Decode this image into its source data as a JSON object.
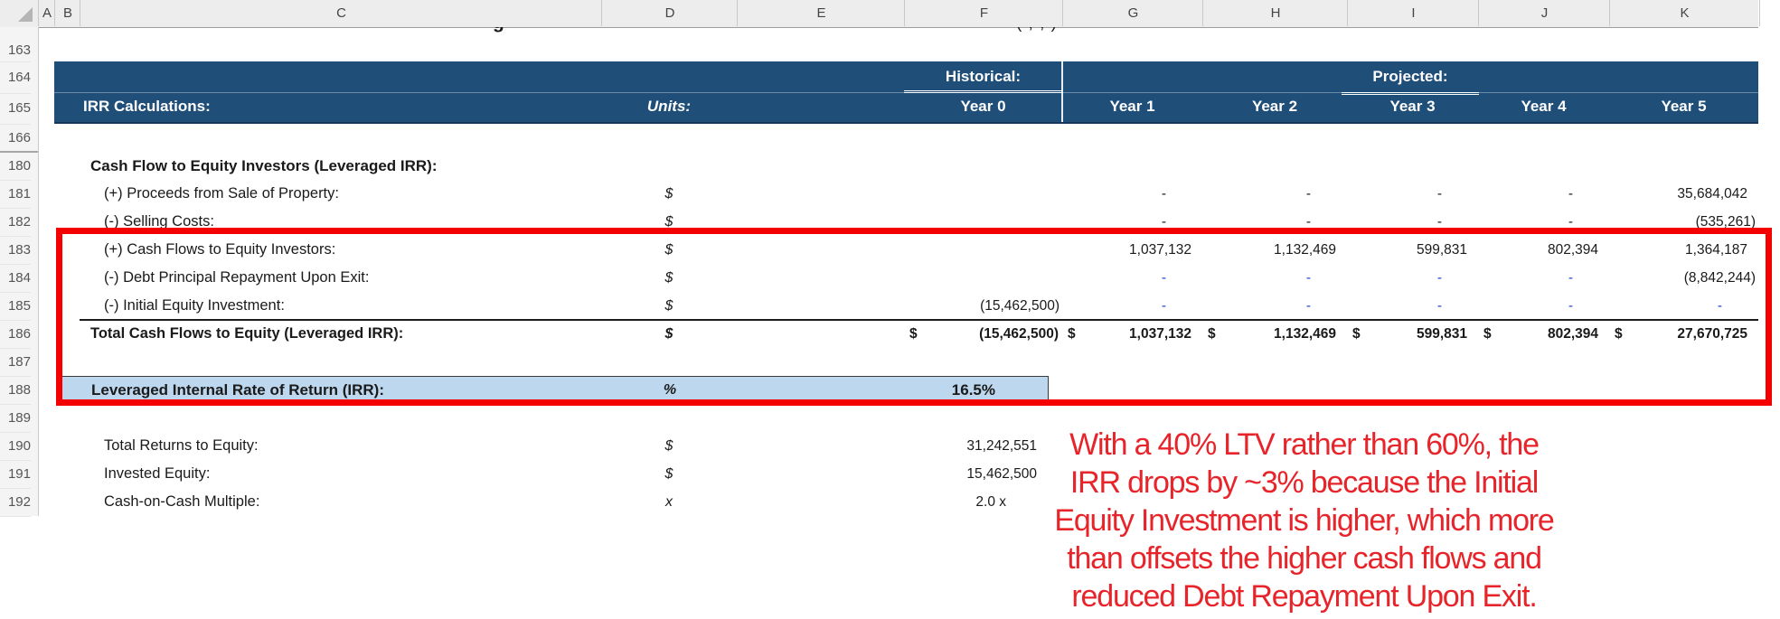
{
  "colors": {
    "header_navy": "#1F4E79",
    "highlight_blue": "#BDD7EE",
    "annotation_red": "#E8242B",
    "box_red": "#F40000",
    "input_value_blue": "#2244CC"
  },
  "column_letters": [
    "A",
    "B",
    "C",
    "D",
    "E",
    "F",
    "G",
    "H",
    "I",
    "J",
    "K"
  ],
  "row_numbers": [
    "163",
    "164",
    "165",
    "166",
    "180",
    "181",
    "182",
    "183",
    "184",
    "185",
    "186",
    "187",
    "188",
    "189",
    "190",
    "191",
    "192"
  ],
  "clipped": {
    "label_fragment": "g",
    "value_fragment": "( , , )"
  },
  "band": {
    "historical": "Historical:",
    "projected": "Projected:",
    "title": "IRR Calculations:",
    "units": "Units:",
    "years": [
      "Year 0",
      "Year 1",
      "Year 2",
      "Year 3",
      "Year 4",
      "Year 5"
    ]
  },
  "section": {
    "title": "Cash Flow to Equity Investors (Leveraged IRR):"
  },
  "line_items": [
    {
      "row": "181",
      "label": "(+) Proceeds from Sale of Property:",
      "units": "$",
      "y1": "-",
      "y2": "-",
      "y3": "-",
      "y4": "-",
      "y5": "35,684,042"
    },
    {
      "row": "182",
      "label": "(-) Selling Costs:",
      "units": "$",
      "y1": "-",
      "y2": "-",
      "y3": "-",
      "y4": "-",
      "y5": "(535,261)"
    },
    {
      "row": "183",
      "label": "(+) Cash Flows to Equity Investors:",
      "units": "$",
      "y1": "1,037,132",
      "y2": "1,132,469",
      "y3": "599,831",
      "y4": "802,394",
      "y5": "1,364,187"
    },
    {
      "row": "184",
      "label": "(-) Debt Principal Repayment Upon Exit:",
      "units": "$",
      "y1": "-",
      "y2": "-",
      "y3": "-",
      "y4": "-",
      "y5": "(8,842,244)"
    },
    {
      "row": "185",
      "label": "(-) Initial Equity Investment:",
      "units": "$",
      "y0": "(15,462,500)",
      "y1": "-",
      "y2": "-",
      "y3": "-",
      "y4": "-",
      "y5": "-"
    }
  ],
  "total_row": {
    "row": "186",
    "label": "Total Cash Flows to Equity (Leveraged IRR):",
    "units": "$",
    "cells": [
      {
        "cur": "$",
        "val": "(15,462,500)"
      },
      {
        "cur": "$",
        "val": "1,037,132"
      },
      {
        "cur": "$",
        "val": "1,132,469"
      },
      {
        "cur": "$",
        "val": "599,831"
      },
      {
        "cur": "$",
        "val": "802,394"
      },
      {
        "cur": "$",
        "val": "27,670,725"
      }
    ]
  },
  "irr_row": {
    "row": "188",
    "label": "Leveraged Internal Rate of Return (IRR):",
    "units": "%",
    "value": "16.5%"
  },
  "summary": [
    {
      "row": "190",
      "label": "Total Returns to Equity:",
      "units": "$",
      "value": "31,242,551"
    },
    {
      "row": "191",
      "label": "Invested Equity:",
      "units": "$",
      "value": "15,462,500"
    },
    {
      "row": "192",
      "label": "Cash-on-Cash Multiple:",
      "units": "x",
      "value": "2.0 x"
    }
  ],
  "annotation": {
    "lines": [
      "With a 40% LTV rather than 60%, the",
      "IRR drops by ~3% because the Initial",
      "Equity Investment is higher, which more",
      "than offsets the higher cash flows and",
      "reduced Debt Repayment Upon Exit."
    ]
  }
}
